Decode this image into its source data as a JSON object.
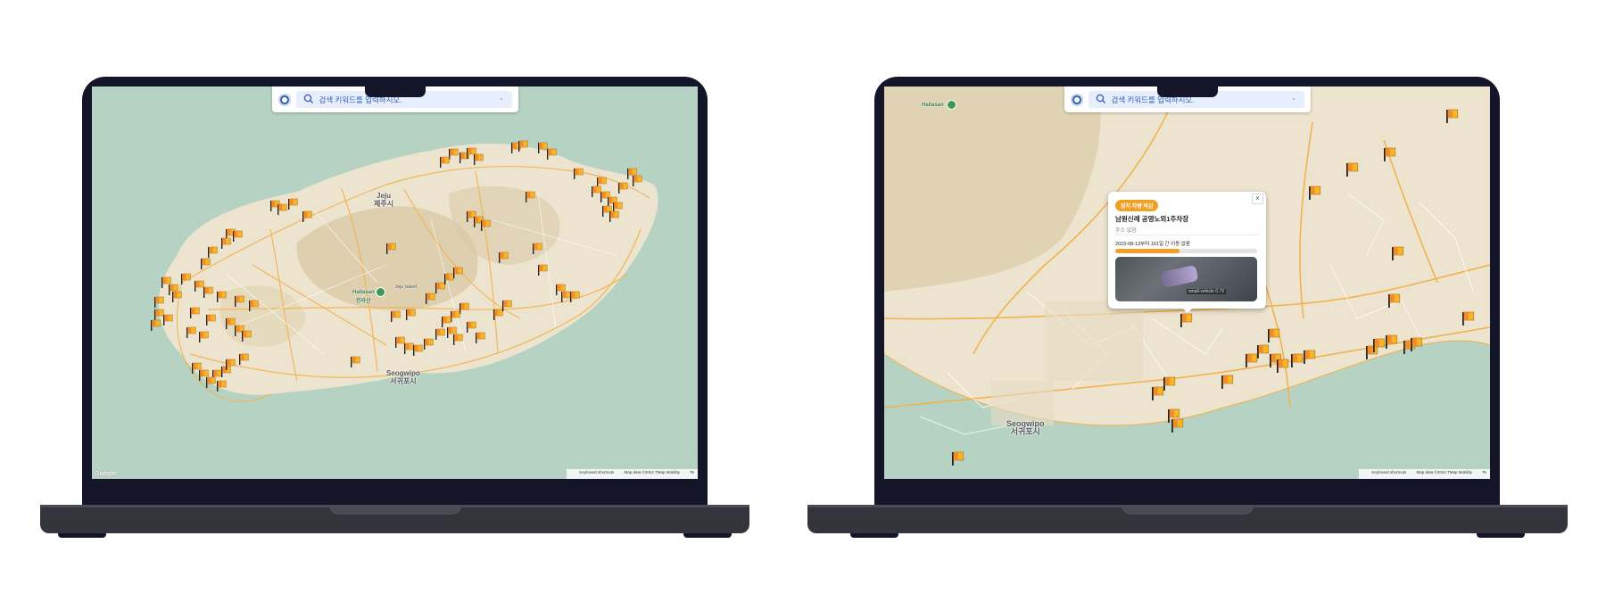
{
  "search": {
    "placeholder": "검색 키워드를 입력하시오."
  },
  "colors": {
    "sea": "#b6d2c2",
    "land": "#ede4cf",
    "road": "#f2b24e",
    "flag_orange": "#f0a024",
    "laptop_bezel": "#15152a",
    "laptop_base": "#34343c",
    "search_accent": "#2e5cb8"
  },
  "left_map": {
    "city_jeju_en": "Jeju",
    "city_jeju_ko": "제주시",
    "city_seogwipo_en": "Seogwipo",
    "city_seogwipo_ko": "서귀포시",
    "peak": "Hallasan",
    "peak_ko": "한라산",
    "forest": "Jeju Island",
    "footer_shortcuts": "Keyboard shortcuts",
    "footer_mapdata": "Map data ©2024 TMap Mobility",
    "footer_terms": "Te",
    "google": "Google"
  },
  "right_map": {
    "peak": "Hallasan",
    "city_en": "Seogwipo",
    "city_ko": "서귀포시",
    "footer_shortcuts": "Keyboard shortcuts",
    "footer_mapdata": "Map data ©2024 TMap Mobility",
    "footer_terms": "Te"
  },
  "popup": {
    "badge": "장치 차량 의심",
    "title": "남원신례 공영노외1주차장",
    "address": "주소 없음",
    "period_text": "2023-08-13부터 161일 간 이동 없음",
    "progress": 0.45,
    "photo_label": "small-vehicle 0.79",
    "close": "×"
  }
}
